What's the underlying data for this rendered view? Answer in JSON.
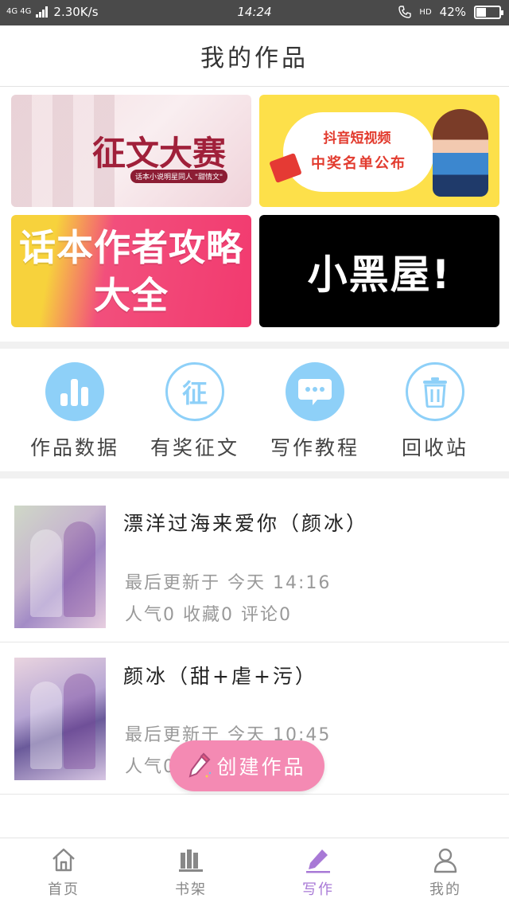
{
  "status_bar": {
    "network": "4G 4G",
    "speed": "2.30K/s",
    "time": "14:24",
    "hd": "HD",
    "battery_text": "42%",
    "battery_level": 0.42
  },
  "header": {
    "title": "我的作品"
  },
  "banners": {
    "contest": {
      "title": "征文大赛",
      "subtitle": "话本小说明星同人 \"甜情文\""
    },
    "douyin": {
      "line1": "抖音短视频",
      "line2": "中奖名单公布"
    },
    "guide": {
      "line1": "话本作者攻略",
      "line2": "大全"
    },
    "blackhouse": {
      "title": "小黑屋!"
    }
  },
  "quick_actions": [
    {
      "label": "作品数据",
      "icon": "bar-chart-icon"
    },
    {
      "label": "有奖征文",
      "icon": "contest-icon",
      "glyph": "征"
    },
    {
      "label": "写作教程",
      "icon": "chat-bubble-icon"
    },
    {
      "label": "回收站",
      "icon": "trash-icon"
    }
  ],
  "works": [
    {
      "title": "漂洋过海来爱你（颜冰）",
      "updated": "最后更新于 今天 14:16",
      "stats": "人气0 收藏0 评论0"
    },
    {
      "title": "颜冰（甜+虐+污）",
      "updated": "最后更新于 今天 10:45",
      "stats": "人气0 收藏0 评论4"
    }
  ],
  "fab": {
    "label": "创建作品"
  },
  "bottom_nav": [
    {
      "label": "首页",
      "icon": "home-icon",
      "active": false
    },
    {
      "label": "书架",
      "icon": "bookshelf-icon",
      "active": false
    },
    {
      "label": "写作",
      "icon": "pencil-icon",
      "active": true
    },
    {
      "label": "我的",
      "icon": "profile-icon",
      "active": false
    }
  ],
  "colors": {
    "accent_blue": "#8ed0f8",
    "fab_pink": "#f48ab3",
    "nav_active": "#a879d6"
  }
}
